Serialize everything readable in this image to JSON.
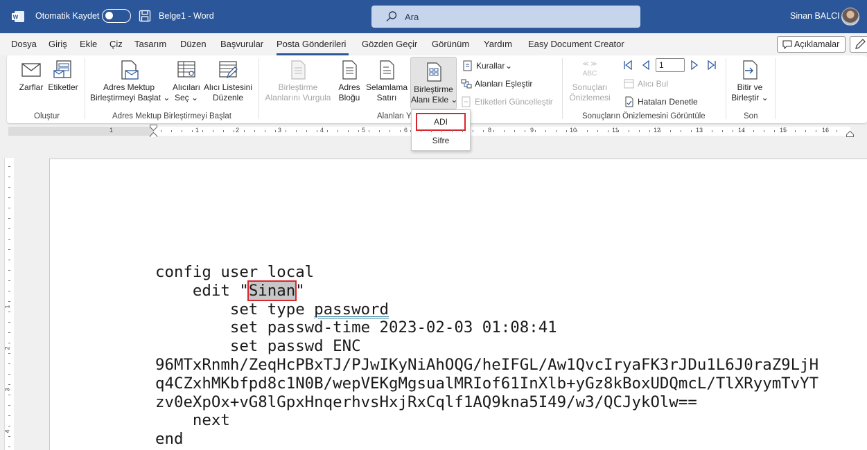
{
  "titlebar": {
    "autosave_label": "Otomatik Kaydet",
    "doc_title": "Belge1  -  Word",
    "search_placeholder": "Ara",
    "user_name": "Sinan BALCI",
    "accent": "#2b579a"
  },
  "tabs": [
    "Dosya",
    "Giriş",
    "Ekle",
    "Çiz",
    "Tasarım",
    "Düzen",
    "Başvurular",
    "Posta Gönderileri",
    "Gözden Geçir",
    "Görünüm",
    "Yardım",
    "Easy Document Creator"
  ],
  "active_tab": "Posta Gönderileri",
  "comments_label": "Açıklamalar",
  "ribbon": {
    "envelopes": "Zarflar",
    "labels": "Etiketler",
    "group_create": "Oluştur",
    "start_merge_1": "Adres Mektup",
    "start_merge_2": "Birleştirmeyi Başlat",
    "select_recipients_1": "Alıcıları",
    "select_recipients_2": "Seç",
    "edit_list_1": "Alıcı Listesini",
    "edit_list_2": "Düzenle",
    "group_start": "Adres Mektup Birleştirmeyi Başlat",
    "highlight_1": "Birleştirme",
    "highlight_2": "Alanlarını Vurgula",
    "address_block_1": "Adres",
    "address_block_2": "Bloğu",
    "greeting_1": "Selamlama",
    "greeting_2": "Satırı",
    "insert_field_1": "Birleştirme",
    "insert_field_2": "Alanı Ekle",
    "group_fields": "Alanları Y",
    "rules": "Kurallar",
    "match_fields": "Alanları Eşleştir",
    "update_labels": "Etiketleri Güncelleştir",
    "preview_1": "Sonuçları",
    "preview_2": "Önizlemesi",
    "record_number": "1",
    "find_recipient": "Alıcı Bul",
    "check_errors": "Hataları Denetle",
    "group_preview": "Sonuçların Önizlemesini Görüntüle",
    "finish_1": "Bitir ve",
    "finish_2": "Birleştir",
    "group_finish": "Son"
  },
  "dropdown": {
    "items": [
      "ADI",
      "Sifre"
    ]
  },
  "ruler_numbers": [
    "1",
    "1",
    "2",
    "3",
    "4",
    "5",
    "6",
    "7",
    "8",
    "9",
    "10",
    "11",
    "12",
    "13",
    "14",
    "15",
    "16"
  ],
  "vruler_numbers": [
    "1",
    "2",
    "3",
    "4"
  ],
  "document": {
    "line1": "config user local",
    "line2_pre": "    edit \"",
    "line2_sel": "Sinan",
    "line2_post": "\"",
    "line3_pre": "        set type ",
    "line3_word": "password",
    "line4": "        set passwd-time 2023-02-03 01:08:41",
    "line5": "        set passwd ENC",
    "line6": "96MTxRnmh/ZeqHcPBxTJ/PJwIKyNiAhOQG/heIFGL/Aw1QvcIryaFK3rJDu1L6J0raZ9LjH",
    "line7": "q4CZxhMKbfpd8c1N0B/wepVEKgMgsualMRIof61InXlb+yGz8kBoxUDQmcL/TlXRyymTvYT",
    "line8": "zv0eXpOx+vG8lGpxHnqerhvsHxjRxCqlf1AQ9kna5I49/w3/QCJykOlw==",
    "line9": "    next",
    "line10": "end"
  }
}
